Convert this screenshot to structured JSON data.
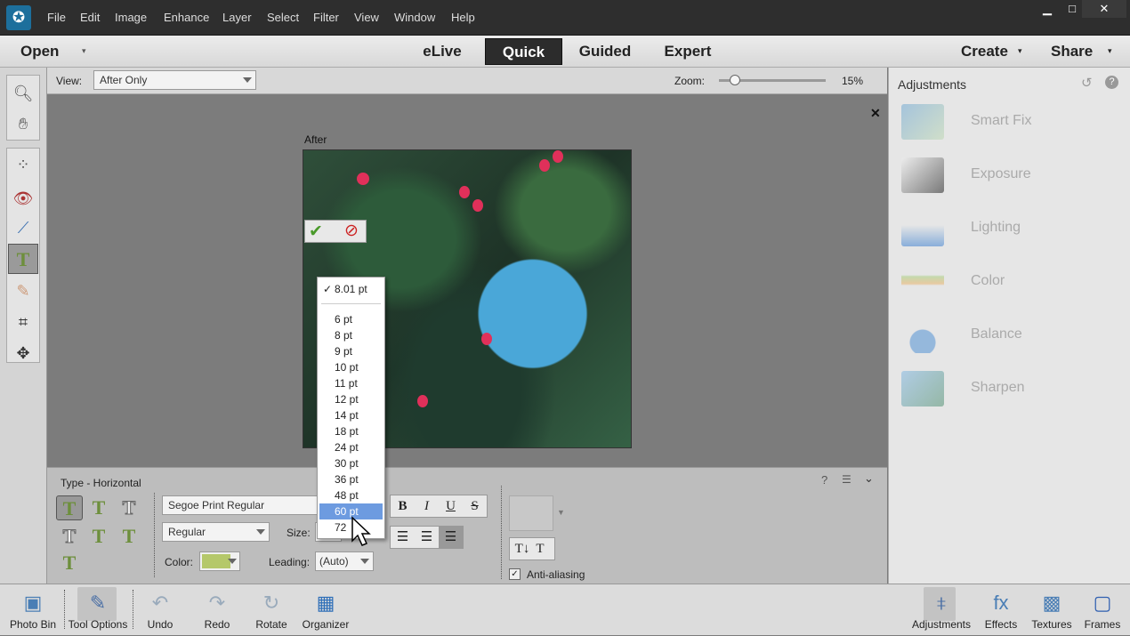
{
  "menubar": {
    "items": [
      "File",
      "Edit",
      "Image",
      "Enhance",
      "Layer",
      "Select",
      "Filter",
      "View",
      "Window",
      "Help"
    ]
  },
  "modebar": {
    "open": "Open",
    "modes": [
      "eLive",
      "Quick",
      "Guided",
      "Expert"
    ],
    "active": "Quick",
    "create": "Create",
    "share": "Share"
  },
  "options": {
    "view_label": "View:",
    "view_value": "After Only",
    "zoom_label": "Zoom:",
    "zoom_value": "15%",
    "zoom_level": 15
  },
  "canvas": {
    "after_label": "After"
  },
  "tool_options": {
    "title": "Type - Horizontal",
    "font": "Segoe Print Regular",
    "style": "Regular",
    "size_label": "Size:",
    "color_label": "Color:",
    "color": "#b5c86a",
    "leading_label": "Leading:",
    "leading_value": "(Auto)",
    "bold": "B",
    "italic": "I",
    "underline": "U",
    "strike": "S",
    "anti_aliasing": "Anti-aliasing",
    "anti_aliasing_checked": true
  },
  "size_dropdown": {
    "current": "8.01 pt",
    "options": [
      "6 pt",
      "8 pt",
      "9 pt",
      "10 pt",
      "11 pt",
      "12 pt",
      "14 pt",
      "18 pt",
      "24 pt",
      "30 pt",
      "36 pt",
      "48 pt",
      "60 pt",
      "72"
    ],
    "highlighted": "60 pt"
  },
  "adjustments": {
    "title": "Adjustments",
    "items": [
      "Smart Fix",
      "Exposure",
      "Lighting",
      "Color",
      "Balance",
      "Sharpen"
    ]
  },
  "bottombar": {
    "left": [
      "Photo Bin",
      "Tool Options",
      "Undo",
      "Redo",
      "Rotate",
      "Organizer"
    ],
    "right": [
      "Adjustments",
      "Effects",
      "Textures",
      "Frames"
    ]
  }
}
